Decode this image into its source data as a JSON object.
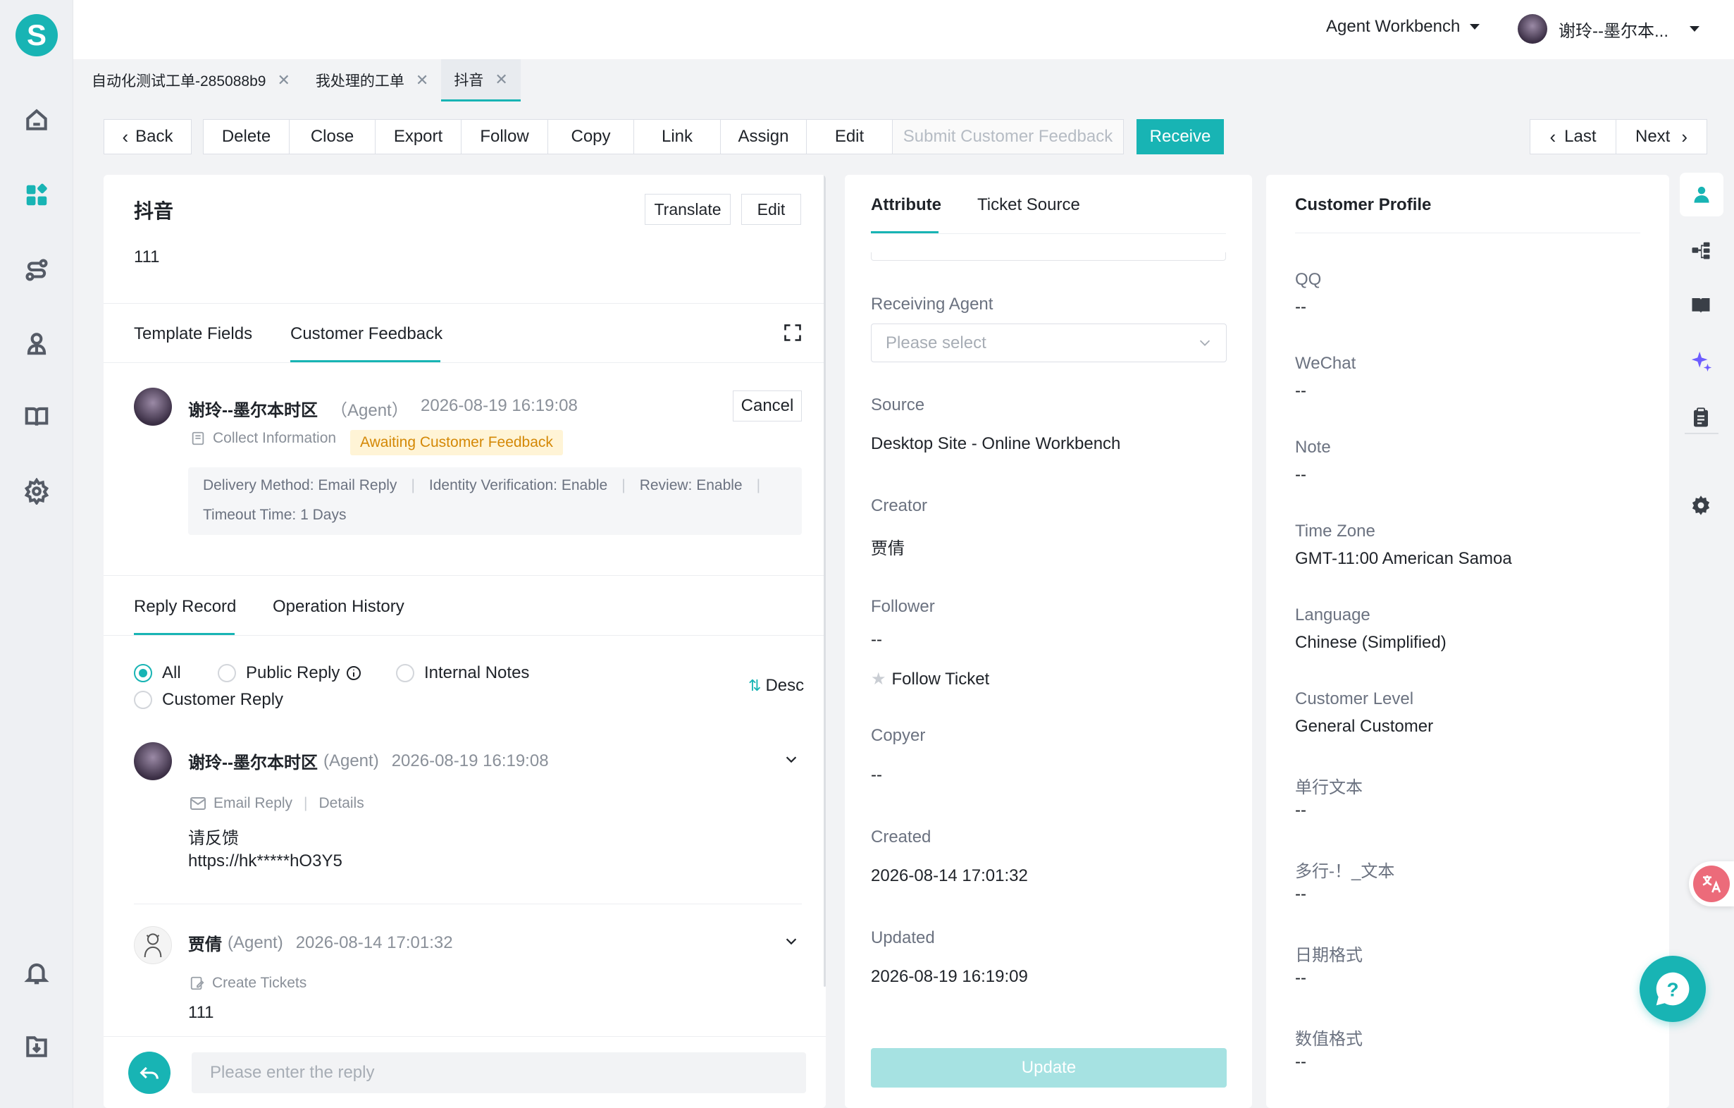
{
  "header": {
    "workspace": "Agent Workbench",
    "user_name": "谢玲--墨尔本..."
  },
  "page_tabs": [
    {
      "label": "自动化测试工单-285088b9"
    },
    {
      "label": "我处理的工单"
    },
    {
      "label": "抖音"
    }
  ],
  "toolbar": {
    "back": "Back",
    "actions": [
      "Delete",
      "Close",
      "Export",
      "Follow",
      "Copy",
      "Link",
      "Assign",
      "Edit"
    ],
    "submit_feedback": "Submit Customer Feedback",
    "receive": "Receive",
    "last": "Last",
    "next": "Next"
  },
  "ticket": {
    "title": "抖音",
    "translate": "Translate",
    "edit": "Edit",
    "description": "111"
  },
  "feedback_tabs": {
    "template_fields": "Template Fields",
    "customer_feedback": "Customer Feedback"
  },
  "feedback": {
    "agent_name": "谢玲--墨尔本时区",
    "agent_role": "（Agent）",
    "time": "2026-08-19 16:19:08",
    "cancel": "Cancel",
    "collect_info": "Collect Information",
    "status": "Awaiting Customer Feedback",
    "delivery": "Delivery Method: Email Reply",
    "identity": "Identity Verification: Enable",
    "review": "Review: Enable",
    "timeout": "Timeout Time: 1 Days"
  },
  "record_tabs": {
    "reply_record": "Reply Record",
    "operation_history": "Operation History"
  },
  "filters": {
    "all": "All",
    "public_reply": "Public Reply",
    "internal_notes": "Internal Notes",
    "customer_reply": "Customer Reply",
    "sort": "Desc"
  },
  "replies": [
    {
      "name": "谢玲--墨尔本时区",
      "role": "(Agent)",
      "time": "2026-08-19 16:19:08",
      "channel": "Email Reply",
      "details": "Details",
      "line1": "请反馈",
      "line2": "https://hk*****hO3Y5"
    },
    {
      "name": "贾倩",
      "role": "(Agent)",
      "time": "2026-08-14 17:01:32",
      "channel": "Create Tickets",
      "line1": "111"
    }
  ],
  "composer": {
    "placeholder": "Please enter the reply"
  },
  "attribute_tabs": {
    "attribute": "Attribute",
    "ticket_source": "Ticket Source"
  },
  "attributes": {
    "receiving_agent_label": "Receiving Agent",
    "receiving_agent_placeholder": "Please select",
    "source_label": "Source",
    "source_value": "Desktop Site - Online Workbench",
    "creator_label": "Creator",
    "creator_value": "贾倩",
    "follower_label": "Follower",
    "follower_value": "--",
    "follow_ticket": "Follow Ticket",
    "copyer_label": "Copyer",
    "copyer_value": "--",
    "created_label": "Created",
    "created_value": "2026-08-14 17:01:32",
    "updated_label": "Updated",
    "updated_value": "2026-08-19 16:19:09",
    "update_button": "Update"
  },
  "profile": {
    "title": "Customer Profile",
    "fields": [
      {
        "label": "QQ",
        "value": "--"
      },
      {
        "label": "WeChat",
        "value": "--"
      },
      {
        "label": "Note",
        "value": "--"
      },
      {
        "label": "Time Zone",
        "value": "GMT-11:00 American Samoa"
      },
      {
        "label": "Language",
        "value": "Chinese (Simplified)"
      },
      {
        "label": "Customer Level",
        "value": "General Customer"
      },
      {
        "label": "单行文本",
        "value": "--"
      },
      {
        "label": "多行-！_文本",
        "value": "--"
      },
      {
        "label": "日期格式",
        "value": "--"
      },
      {
        "label": "数值格式",
        "value": "--"
      }
    ]
  },
  "colors": {
    "accent": "#18b4b4",
    "status_bg": "#fff4d6",
    "status_text": "#d48806"
  }
}
